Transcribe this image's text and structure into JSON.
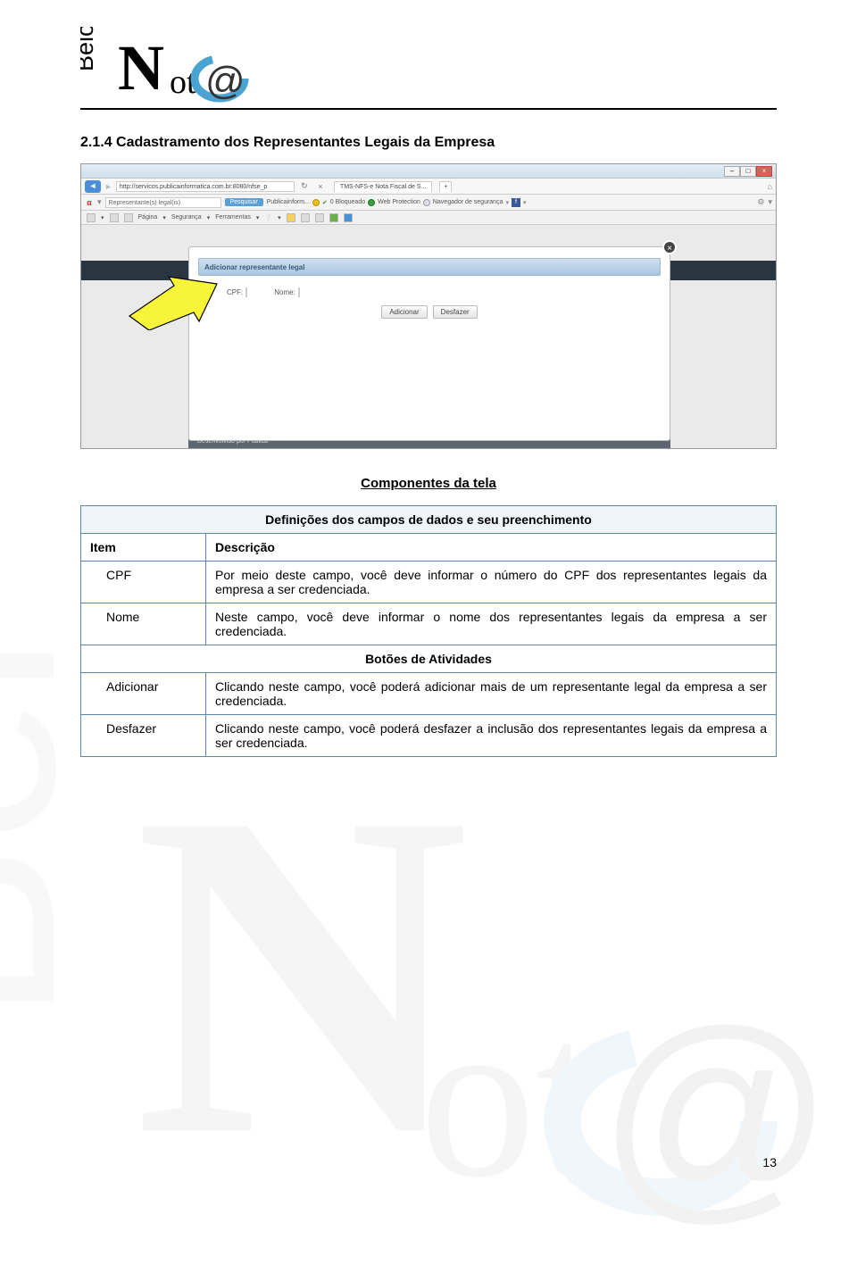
{
  "logo": {
    "text_belo": "Belo",
    "text_not": "Not",
    "at": "@"
  },
  "section_number": "2.1.4 ",
  "section_title": "Cadastramento dos Representantes Legais da Empresa",
  "screenshot": {
    "url": "http://servicos.publicainformatica.com.br:8080/nfse_p",
    "tab": "TMS-NFS-e Nota Fiscal de S...",
    "search_placeholder": "Representante(s) legal(is)",
    "search_btn": "Pesquisar",
    "status_items": [
      "Publicainform...",
      "0 Bloqueado",
      "Web Protection",
      "Navegador de segurança"
    ],
    "toolbar_items": [
      "Página",
      "Segurança",
      "Ferramentas"
    ],
    "modal_title": "Adicionar representante legal",
    "modal_cpf_label": "CPF:",
    "modal_nome_label": "Nome:",
    "modal_btn_add": "Adicionar",
    "modal_btn_undo": "Desfazer",
    "footer_left": "Desenvolvido por Pública",
    "footer_right": ""
  },
  "table_caption": "Componentes da tela",
  "table": {
    "header": "Definições dos campos de dados e seu preenchimento",
    "col_item": "Item",
    "col_desc": "Descrição",
    "rows": [
      {
        "item": "CPF",
        "desc": "Por meio deste campo, você deve informar o número do CPF dos representantes legais da empresa a ser credenciada."
      },
      {
        "item": "Nome",
        "desc": "Neste campo, você deve informar o nome dos representantes legais da empresa a ser credenciada."
      }
    ],
    "subheader": "Botões de Atividades",
    "rows2": [
      {
        "item": "Adicionar",
        "desc": "Clicando neste campo, você poderá adicionar mais de um representante legal da empresa a ser credenciada."
      },
      {
        "item": "Desfazer",
        "desc": "Clicando neste campo, você poderá desfazer a inclusão dos representantes legais da empresa a ser credenciada."
      }
    ]
  },
  "page_number": "13"
}
